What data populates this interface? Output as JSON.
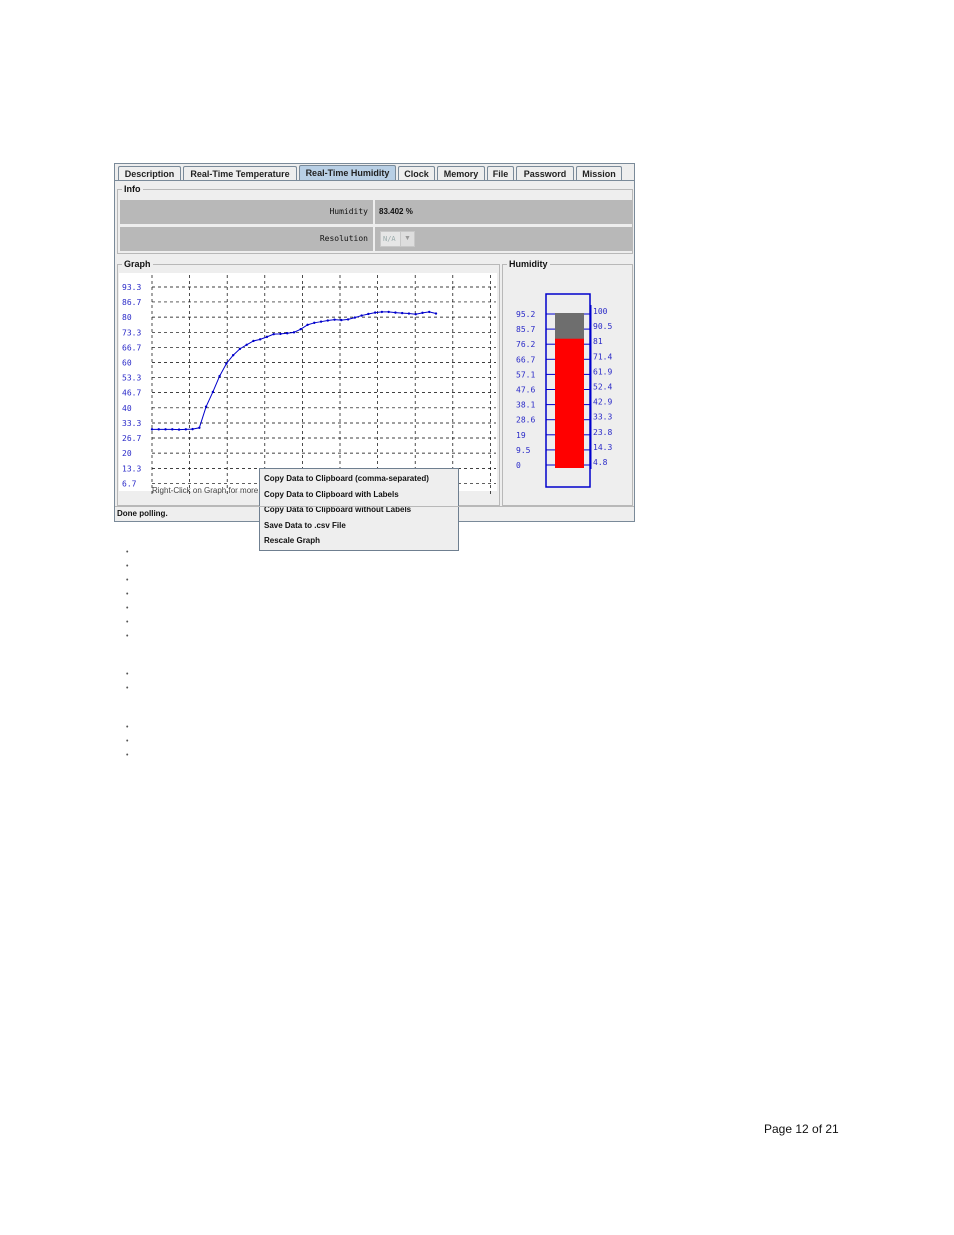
{
  "tabs": [
    "Description",
    "Real-Time Temperature",
    "Real-Time Humidity",
    "Clock",
    "Memory",
    "File",
    "Password",
    "Mission"
  ],
  "active_tab": "Real-Time Humidity",
  "info": {
    "title": "Info",
    "humidity_label": "Humidity",
    "humidity_value": "83.402 %",
    "resolution_label": "Resolution",
    "resolution_value": "N/A"
  },
  "graph": {
    "title": "Graph",
    "hint": "Right-Click on Graph for more options.",
    "context_menu": [
      "Copy Data to Clipboard (comma-separated)",
      "Copy Data to Clipboard with Labels",
      "Copy Data to Clipboard without Labels",
      "Save Data to .csv File",
      "Rescale Graph"
    ]
  },
  "chart_data": {
    "type": "line",
    "title": "Graph",
    "xlabel": "",
    "ylabel": "",
    "y_ticks": [
      "93.3",
      "86.7",
      "80",
      "73.3",
      "66.7",
      "60",
      "53.3",
      "46.7",
      "40",
      "33.3",
      "26.7",
      "20",
      "13.3",
      "6.7"
    ],
    "ylim": [
      6.7,
      93.3
    ],
    "series": [
      {
        "color": "#0000cc",
        "values": [
          30.5,
          30.5,
          30.5,
          30.5,
          30.4,
          30.5,
          30.6,
          31.2,
          40.5,
          47.0,
          54.0,
          59.5,
          63.2,
          66.0,
          67.8,
          69.5,
          70.2,
          71.3,
          72.5,
          72.6,
          72.9,
          73.3,
          74.7,
          76.6,
          77.5,
          78.0,
          78.5,
          78.9,
          78.7,
          79.0,
          79.8,
          80.7,
          81.4,
          82.0,
          82.3,
          82.3,
          82.0,
          81.8,
          81.6,
          81.3,
          81.9,
          82.3,
          81.6
        ]
      }
    ],
    "grid": true
  },
  "humidity_gauge": {
    "title": "Humidity",
    "value": 83.402,
    "max_value": 100,
    "left_scale": [
      "95.2",
      "85.7",
      "76.2",
      "66.7",
      "57.1",
      "47.6",
      "38.1",
      "28.6",
      "19",
      "9.5",
      "0"
    ],
    "right_scale": [
      "100",
      "90.5",
      "81",
      "71.4",
      "61.9",
      "52.4",
      "42.9",
      "33.3",
      "23.8",
      "14.3",
      "4.8"
    ],
    "fill_color": "#ff0000",
    "empty_color": "#6e6e6e",
    "frame_color": "#0000cc"
  },
  "status_text": "Done polling.",
  "page_number": "Page 12 of 21"
}
